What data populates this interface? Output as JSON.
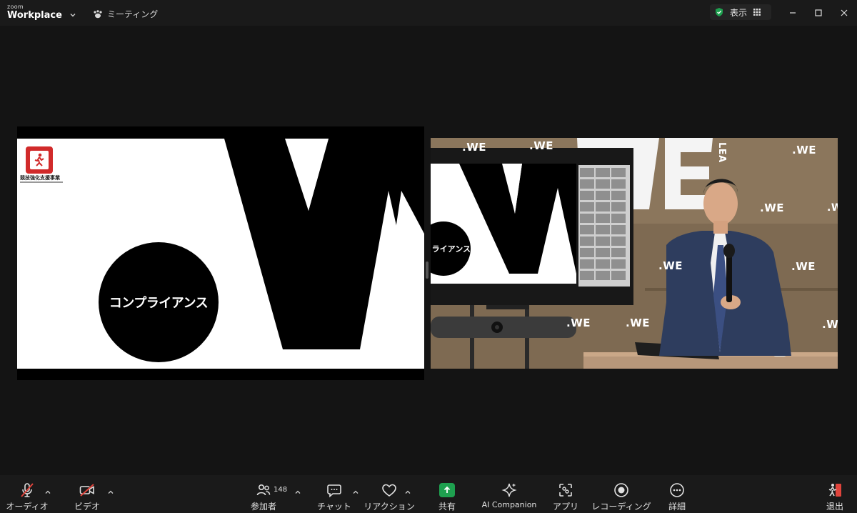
{
  "titlebar": {
    "brand_small": "zoom",
    "brand_large": "Workplace",
    "meeting_label": "ミーティング",
    "view_label": "表示"
  },
  "share": {
    "org_label": "競技強化支援事業",
    "circle_text": "コンプライアンス"
  },
  "video": {
    "monitor_label": "ライアンス",
    "wall_text": ".WE",
    "wall_text_big": "WE",
    "wall_text_side": "LEA"
  },
  "toolbar": {
    "audio_label": "オーディオ",
    "video_label": "ビデオ",
    "participants_label": "参加者",
    "participants_count": "148",
    "chat_label": "チャット",
    "reaction_label": "リアクション",
    "share_label": "共有",
    "ai_label": "AI Companion",
    "apps_label": "アプリ",
    "record_label": "レコーディング",
    "more_label": "詳細",
    "leave_label": "退出"
  },
  "colors": {
    "accent_green": "#1ea04f",
    "muted_red": "#e0443c",
    "background": "#141414",
    "bar": "#1a1a1a"
  },
  "icons": {
    "audio": "mic-muted-icon",
    "video": "camera-off-icon",
    "participants": "people-icon",
    "chat": "chat-bubble-icon",
    "reaction": "heart-icon",
    "share": "share-screen-icon",
    "ai": "sparkle-icon",
    "apps": "apps-icon",
    "record": "record-icon",
    "more": "more-dots-icon",
    "leave": "leave-icon",
    "security": "shield-check-icon"
  }
}
